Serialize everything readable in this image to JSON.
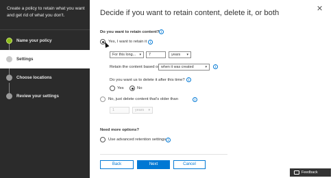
{
  "wizard": {
    "intro": "Create a policy to retain what you want and get rid of what you don't.",
    "steps": [
      {
        "label": "Name your policy",
        "state": "done"
      },
      {
        "label": "Settings",
        "state": "active"
      },
      {
        "label": "Choose locations",
        "state": "pending"
      },
      {
        "label": "Review your settings",
        "state": "pending"
      }
    ]
  },
  "panel": {
    "title": "Decide if you want to retain content, delete it, or both",
    "close_icon": "close-icon"
  },
  "retain": {
    "question": "Do you want to retain content?",
    "yes_label": "Yes, I want to retain it",
    "yes_selected": true,
    "duration_select": "For this long...",
    "duration_value": "7",
    "duration_unit": "years",
    "based_on_label": "Retain the content based on",
    "based_on_value": "when it was created",
    "delete_after_question": "Do you want us to delete it after this time?",
    "delete_yes": "Yes",
    "delete_no": "No",
    "delete_selected": "No",
    "no_label": "No, just delete content that's older than",
    "older_value": "1",
    "older_unit": "years"
  },
  "more": {
    "heading": "Need more options?",
    "advanced_label": "Use advanced retention settings"
  },
  "footer": {
    "back": "Back",
    "next": "Next",
    "cancel": "Cancel",
    "feedback": "Feedback"
  },
  "colors": {
    "accent": "#0078d4",
    "left_panel": "#2b2b2b",
    "done_step": "#8cbd18"
  }
}
